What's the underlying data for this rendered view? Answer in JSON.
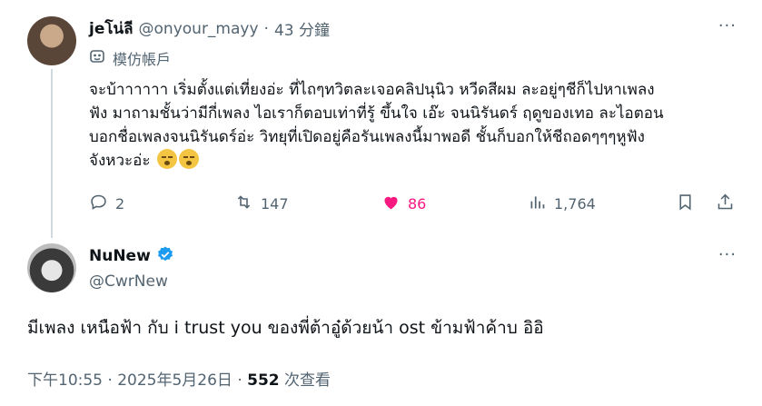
{
  "post1": {
    "display_name": "jeโน่ลี",
    "handle": "@onyour_mayy",
    "separator": "·",
    "time_ago": "43 分鐘",
    "more_label": "···",
    "parody_label": "模仿帳戶",
    "text_lines": [
      "จะบ้าาาาาา เริ่มตั้งแต่เที่ยงอ่ะ ที่ไถๆทวิตละเจอคลิปนุนิว หวีดสีผม ละอยู่ๆชีก็ไปหาเพลง",
      "ฟัง มาถามชั้นว่ามีกี่เพลง ไอเราก็ตอบเท่าที่รู้ ขึ้นใจ เอ๊ะ จนนิรันดร์ ฤดูของเทอ ละไอตอน",
      "บอกชื่อเพลงจนนิรันดร์อ่ะ วิทยุที่เปิดอยู่คือรันเพลงนี้มาพอดี ชั้นก็บอกให้ชีถอดๆๆๆหูฟัง",
      "จังหวะอ่ะ"
    ],
    "emoji_icons": [
      "astonished-face-icon",
      "astonished-face-icon"
    ],
    "actions": {
      "replies": "2",
      "reposts": "147",
      "likes": "86",
      "views": "1,764"
    },
    "like_color": "#f91880"
  },
  "post2": {
    "display_name": "NuNew",
    "handle": "@CwrNew",
    "more_label": "···",
    "text": "มีเพลง เหนือฟ้า กับ i trust you ของพี่ต้าอู๋ด้วยน้า ost ข้ามฟ้าค้าบ อิอิ",
    "timestamp": "下午10:55 · 2025年5月26日 · ",
    "view_count": "552",
    "view_suffix": " 次查看",
    "verified_color": "#1d9bf0"
  }
}
